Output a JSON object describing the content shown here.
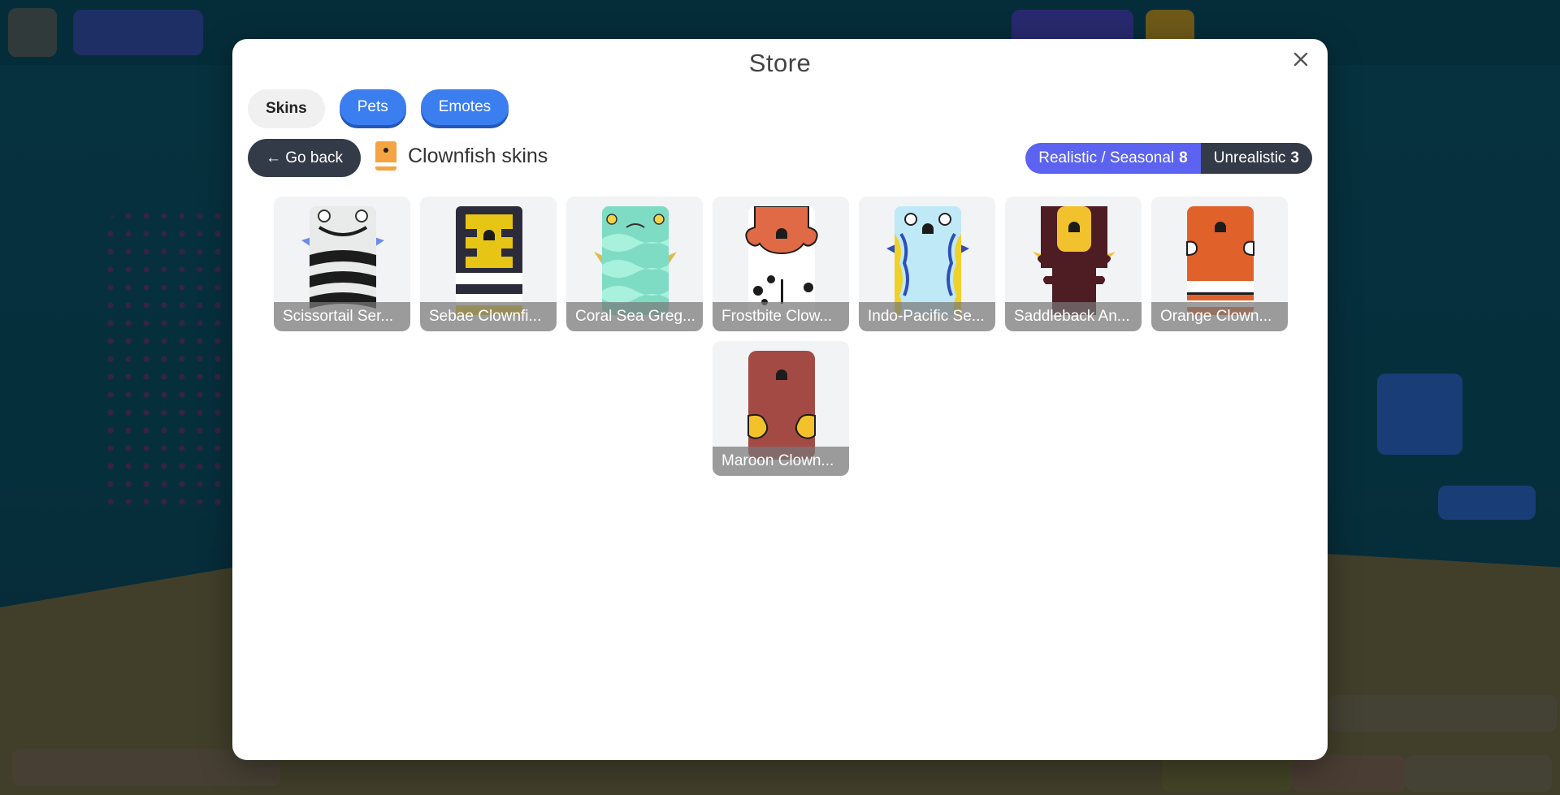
{
  "store": {
    "title": "Store",
    "close_icon": "close-icon",
    "tabs": [
      {
        "label": "Skins",
        "state": "inactive"
      },
      {
        "label": "Pets",
        "state": "active"
      },
      {
        "label": "Emotes",
        "state": "active"
      }
    ],
    "back_label": "← Go back",
    "breadcrumb": "Clownfish skins",
    "filters": [
      {
        "label": "Realistic / Seasonal",
        "count": "8",
        "selected": true
      },
      {
        "label": "Unrealistic",
        "count": "3",
        "selected": false
      }
    ],
    "items": [
      {
        "name": "Scissortail Ser...",
        "color": "#e8ebe9",
        "accent": "#1c1c1c"
      },
      {
        "name": "Sebae Clownfi...",
        "color": "#e7c514",
        "accent": "#2b2b3b"
      },
      {
        "name": "Coral Sea Greg...",
        "color": "#7fdcc4",
        "accent": "#a8f1dd"
      },
      {
        "name": "Frostbite Clow...",
        "color": "#e06a45",
        "accent": "#ffffff"
      },
      {
        "name": "Indo-Pacific Se...",
        "color": "#bfe9f7",
        "accent": "#2e4fb8"
      },
      {
        "name": "Saddleback An...",
        "color": "#4e1c23",
        "accent": "#f2c12e"
      },
      {
        "name": "Orange Clown...",
        "color": "#e0622a",
        "accent": "#ffffff"
      },
      {
        "name": "Maroon Clown...",
        "color": "#a34a45",
        "accent": "#f3c22a"
      }
    ]
  }
}
